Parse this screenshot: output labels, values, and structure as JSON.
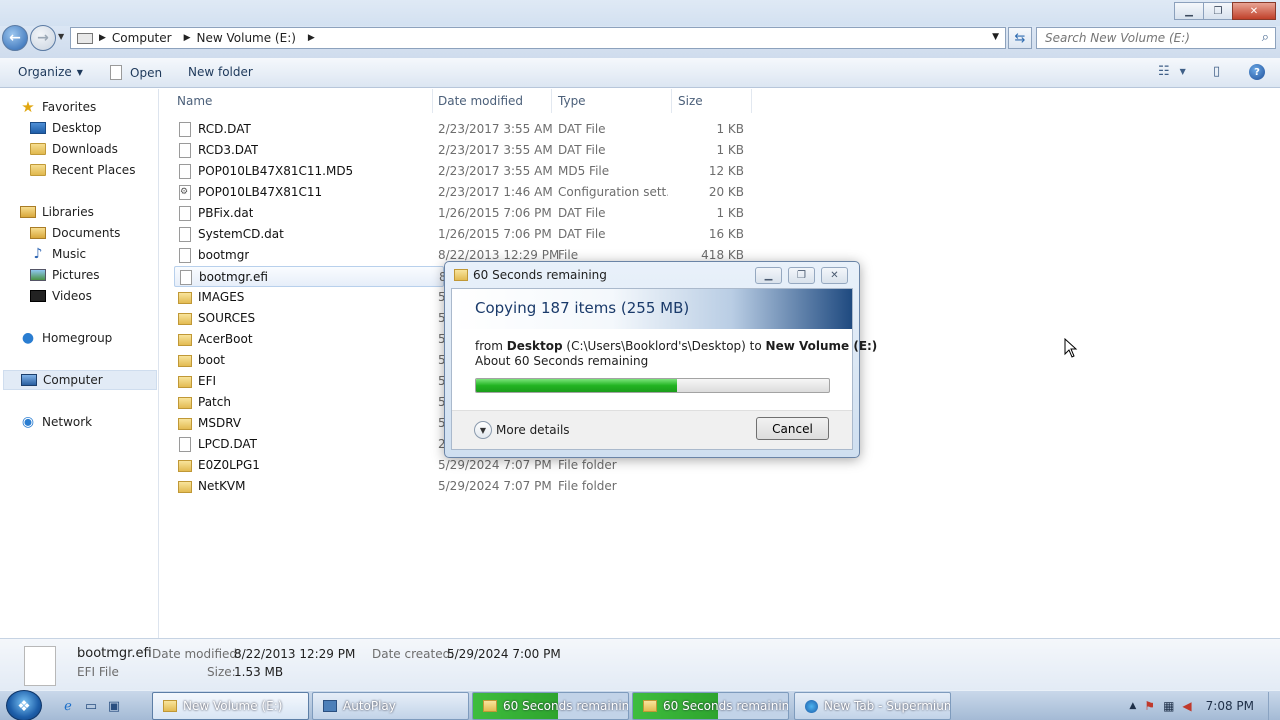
{
  "address": {
    "segments": [
      "Computer",
      "New Volume (E:)"
    ],
    "search_placeholder": "Search New Volume (E:)"
  },
  "toolbar": {
    "organize_label": "Organize",
    "open_label": "Open",
    "new_folder_label": "New folder"
  },
  "nav": {
    "favorites": "Favorites",
    "desktop": "Desktop",
    "downloads": "Downloads",
    "recent_places": "Recent Places",
    "libraries": "Libraries",
    "documents": "Documents",
    "music": "Music",
    "pictures": "Pictures",
    "videos": "Videos",
    "homegroup": "Homegroup",
    "computer": "Computer",
    "network": "Network"
  },
  "columns": {
    "name": "Name",
    "date": "Date modified",
    "type": "Type",
    "size": "Size"
  },
  "files": [
    {
      "name": "RCD.DAT",
      "date": "2/23/2017 3:55 AM",
      "type": "DAT File",
      "size": "1 KB",
      "icon": "file"
    },
    {
      "name": "RCD3.DAT",
      "date": "2/23/2017 3:55 AM",
      "type": "DAT File",
      "size": "1 KB",
      "icon": "file"
    },
    {
      "name": "POP010LB47X81C11.MD5",
      "date": "2/23/2017 3:55 AM",
      "type": "MD5 File",
      "size": "12 KB",
      "icon": "file"
    },
    {
      "name": "POP010LB47X81C11",
      "date": "2/23/2017 1:46 AM",
      "type": "Configuration sett...",
      "size": "20 KB",
      "icon": "config"
    },
    {
      "name": "PBFix.dat",
      "date": "1/26/2015 7:06 PM",
      "type": "DAT File",
      "size": "1 KB",
      "icon": "file"
    },
    {
      "name": "SystemCD.dat",
      "date": "1/26/2015 7:06 PM",
      "type": "DAT File",
      "size": "16 KB",
      "icon": "file"
    },
    {
      "name": "bootmgr",
      "date": "8/22/2013 12:29 PM",
      "type": "File",
      "size": "418 KB",
      "icon": "file"
    },
    {
      "name": "bootmgr.efi",
      "date": "8",
      "type": "",
      "size": "",
      "icon": "file"
    },
    {
      "name": "IMAGES",
      "date": "5",
      "type": "",
      "size": "",
      "icon": "folder"
    },
    {
      "name": "SOURCES",
      "date": "5",
      "type": "",
      "size": "",
      "icon": "folder"
    },
    {
      "name": "AcerBoot",
      "date": "5",
      "type": "",
      "size": "",
      "icon": "folder"
    },
    {
      "name": "boot",
      "date": "5",
      "type": "",
      "size": "",
      "icon": "folder"
    },
    {
      "name": "EFI",
      "date": "5",
      "type": "",
      "size": "",
      "icon": "folder"
    },
    {
      "name": "Patch",
      "date": "5",
      "type": "",
      "size": "",
      "icon": "folder"
    },
    {
      "name": "MSDRV",
      "date": "5",
      "type": "",
      "size": "",
      "icon": "folder"
    },
    {
      "name": "LPCD.DAT",
      "date": "2",
      "type": "",
      "size": "",
      "icon": "file"
    },
    {
      "name": "E0Z0LPG1",
      "date": "5/29/2024 7:07 PM",
      "type": "File folder",
      "size": "",
      "icon": "folder"
    },
    {
      "name": "NetKVM",
      "date": "5/29/2024 7:07 PM",
      "type": "File folder",
      "size": "",
      "icon": "folder"
    }
  ],
  "details": {
    "filename": "bootmgr.efi",
    "filetype": "EFI File",
    "date_modified_label": "Date modified:",
    "date_modified": "8/22/2013 12:29 PM",
    "size_label": "Size:",
    "size": "1.53 MB",
    "date_created_label": "Date created:",
    "date_created": "5/29/2024 7:00 PM"
  },
  "dialog": {
    "title": "60 Seconds remaining",
    "heading": "Copying 187 items (255 MB)",
    "from_word": "from",
    "source_name": "Desktop",
    "source_path": "(C:\\Users\\Booklord's\\Desktop)",
    "to_word": "to",
    "dest_name": "New Volume (E:)",
    "remaining": "About 60 Seconds remaining",
    "progress_percent": 57,
    "more_details": "More details",
    "cancel": "Cancel"
  },
  "taskbar": {
    "buttons": [
      "New Volume (E:)",
      "AutoPlay",
      "60 Seconds remaining",
      "60 Seconds remaining",
      "New Tab - Supermium"
    ],
    "clock": "7:08 PM"
  },
  "colors": {
    "progress_green": "#22b422",
    "selection_blue": "#e2ebf6",
    "accent": "#2a65b0"
  }
}
